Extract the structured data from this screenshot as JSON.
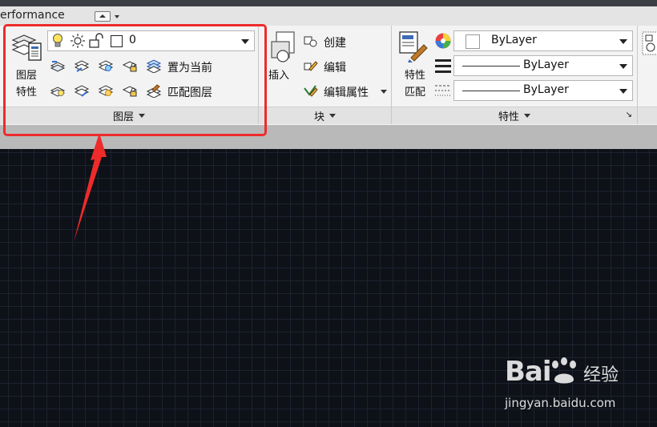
{
  "titlebar": {
    "workspace_label": "erformance"
  },
  "layer_panel": {
    "big_button_line1": "图层",
    "big_button_line2": "特性",
    "layer_combo_value": "0",
    "set_current_label": "置为当前",
    "match_layer_label": "匹配图层",
    "panel_title": "图层"
  },
  "block_panel": {
    "insert_label": "插入",
    "create_label": "创建",
    "edit_label": "编辑",
    "edit_attr_label": "编辑属性",
    "panel_title": "块"
  },
  "properties_panel": {
    "match_line1": "特性",
    "match_line2": "匹配",
    "color_value": "ByLayer",
    "linetype_value": "ByLayer",
    "lineweight_value": "ByLayer",
    "panel_title": "特性"
  },
  "watermark": {
    "brand": "Bai",
    "brand2": "经验",
    "url": "jingyan.baidu.com"
  },
  "colors": {
    "highlight": "#ee2b2b",
    "canvas": "#0e1117"
  },
  "icons": [
    "layer-properties-icon",
    "lightbulb-icon",
    "sun-icon",
    "unlock-icon",
    "color-square-icon",
    "insert-block-icon",
    "create-block-icon",
    "edit-block-icon",
    "edit-attributes-icon",
    "match-properties-icon",
    "color-wheel-icon",
    "lineweight-icon",
    "linetype-icon"
  ]
}
